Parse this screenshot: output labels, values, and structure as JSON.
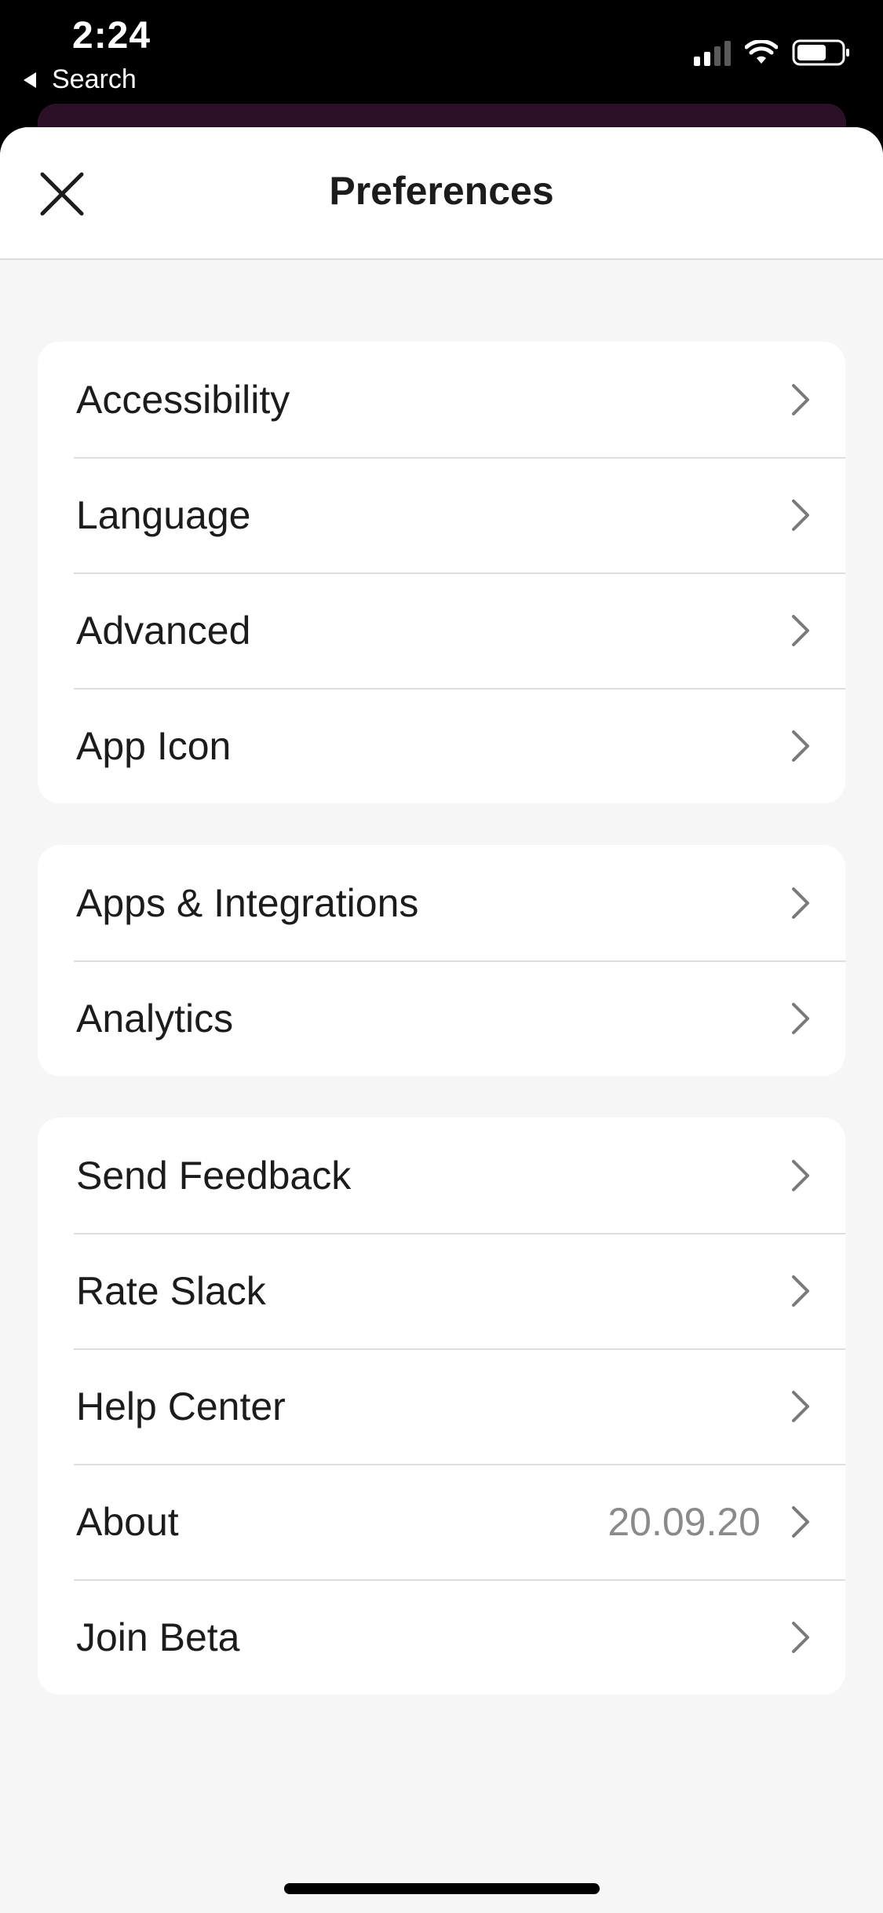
{
  "status_bar": {
    "time": "2:24",
    "back_label": "Search"
  },
  "header": {
    "title": "Preferences"
  },
  "groups": [
    {
      "items": [
        {
          "label": "Accessibility"
        },
        {
          "label": "Language"
        },
        {
          "label": "Advanced"
        },
        {
          "label": "App Icon"
        }
      ]
    },
    {
      "items": [
        {
          "label": "Apps & Integrations"
        },
        {
          "label": "Analytics"
        }
      ]
    },
    {
      "items": [
        {
          "label": "Send Feedback"
        },
        {
          "label": "Rate Slack"
        },
        {
          "label": "Help Center"
        },
        {
          "label": "About",
          "value": "20.09.20"
        },
        {
          "label": "Join Beta"
        }
      ]
    }
  ],
  "colors": {
    "app_accent": "#2b1028",
    "text": "#1d1c1d",
    "secondary_text": "#8a8a8a"
  },
  "icons": [
    "close-icon",
    "chevron-right-icon",
    "cellular-signal-icon",
    "wifi-icon",
    "battery-icon"
  ]
}
